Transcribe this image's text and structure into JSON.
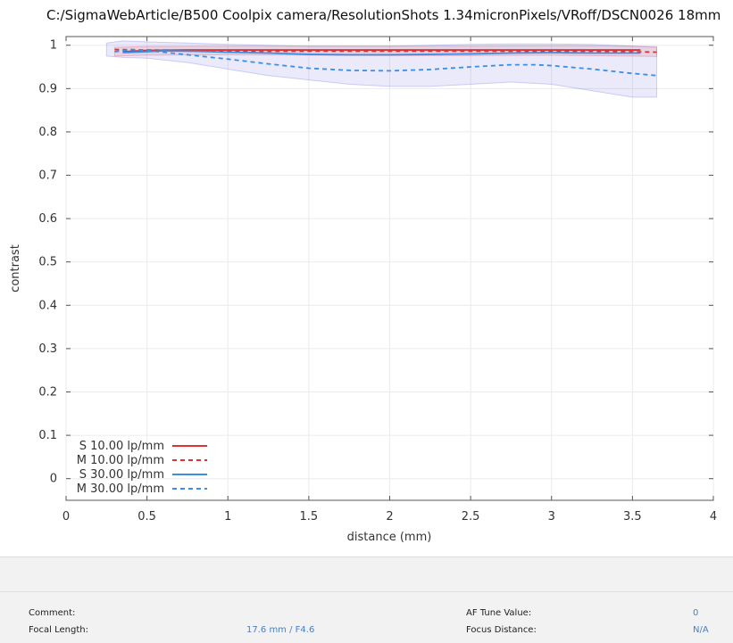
{
  "chart_data": {
    "type": "line",
    "title": "C:/SigmaWebArticle/B500 Coolpix camera/ResolutionShots 1.34micronPixels/VRoff/DSCN0026 18mm",
    "xlabel": "distance (mm)",
    "ylabel": "contrast",
    "xlim": [
      0,
      4
    ],
    "ylim": [
      -0.05,
      1.02
    ],
    "xticks": [
      "0",
      "0.5",
      "1",
      "1.5",
      "2",
      "2.5",
      "3",
      "3.5",
      "4"
    ],
    "yticks": [
      "0",
      "0.1",
      "0.2",
      "0.3",
      "0.4",
      "0.5",
      "0.6",
      "0.7",
      "0.8",
      "0.9",
      "1"
    ],
    "grid": true,
    "legend_position": "bottom-left",
    "series": [
      {
        "name": "S 10.00 lp/mm",
        "color": "#e03030",
        "style": "solid",
        "x": [
          0.35,
          0.5,
          0.75,
          1.0,
          1.25,
          1.5,
          1.75,
          2.0,
          2.25,
          2.5,
          2.75,
          3.0,
          3.25,
          3.55
        ],
        "y": [
          0.985,
          0.988,
          0.989,
          0.989,
          0.989,
          0.989,
          0.989,
          0.989,
          0.989,
          0.989,
          0.989,
          0.989,
          0.989,
          0.989
        ]
      },
      {
        "name": "M 10.00 lp/mm",
        "color": "#e03030",
        "style": "dashed",
        "x": [
          0.3,
          0.5,
          0.75,
          1.0,
          1.25,
          1.5,
          1.75,
          2.0,
          2.25,
          2.5,
          2.75,
          3.0,
          3.25,
          3.5,
          3.65
        ],
        "y": [
          0.99,
          0.989,
          0.988,
          0.987,
          0.986,
          0.986,
          0.986,
          0.986,
          0.986,
          0.986,
          0.986,
          0.986,
          0.986,
          0.985,
          0.984
        ]
      },
      {
        "name": "S 30.00 lp/mm",
        "color": "#3a8ee6",
        "style": "solid",
        "x": [
          0.35,
          0.5,
          0.6,
          0.8,
          1.0,
          1.25,
          1.5,
          1.75,
          2.0,
          2.25,
          2.5,
          2.75,
          3.0,
          3.25,
          3.55
        ],
        "y": [
          0.983,
          0.985,
          0.987,
          0.986,
          0.984,
          0.982,
          0.979,
          0.978,
          0.978,
          0.979,
          0.98,
          0.982,
          0.983,
          0.982,
          0.982
        ]
      },
      {
        "name": "M 30.00 lp/mm",
        "color": "#3a8ee6",
        "style": "dashed",
        "x": [
          0.3,
          0.4,
          0.5,
          0.6,
          0.75,
          1.0,
          1.25,
          1.5,
          1.75,
          2.0,
          2.25,
          2.5,
          2.75,
          2.9,
          3.0,
          3.25,
          3.5,
          3.65
        ],
        "y": [
          0.985,
          0.99,
          0.988,
          0.984,
          0.978,
          0.968,
          0.957,
          0.947,
          0.942,
          0.941,
          0.944,
          0.95,
          0.955,
          0.955,
          0.953,
          0.945,
          0.935,
          0.93
        ]
      }
    ],
    "bands": [
      {
        "color": "#e03030",
        "x": [
          0.3,
          0.5,
          1.0,
          1.5,
          2.0,
          2.5,
          3.0,
          3.5,
          3.65
        ],
        "lower": [
          0.975,
          0.977,
          0.978,
          0.977,
          0.976,
          0.976,
          0.977,
          0.975,
          0.974
        ],
        "upper": [
          0.995,
          0.997,
          0.998,
          0.998,
          0.998,
          0.998,
          0.999,
          0.998,
          0.997
        ]
      },
      {
        "color": "#5050e0",
        "x": [
          0.25,
          0.35,
          0.5,
          0.75,
          1.0,
          1.25,
          1.5,
          1.75,
          2.0,
          2.25,
          2.5,
          2.75,
          3.0,
          3.25,
          3.5,
          3.65
        ],
        "lower": [
          0.975,
          0.972,
          0.97,
          0.96,
          0.945,
          0.93,
          0.92,
          0.91,
          0.905,
          0.905,
          0.91,
          0.915,
          0.91,
          0.895,
          0.88,
          0.88
        ],
        "upper": [
          1.005,
          1.01,
          1.008,
          1.005,
          1.002,
          1.0,
          0.998,
          0.998,
          0.998,
          1.0,
          1.002,
          1.003,
          1.003,
          1.002,
          0.998,
          0.995
        ]
      }
    ]
  },
  "footer": {
    "comment_label": "Comment:",
    "comment_value": "",
    "focal_label": "Focal Length:",
    "focal_value": "17.6 mm / F4.6",
    "af_label": "AF Tune Value:",
    "af_value": "0",
    "focus_label": "Focus Distance:",
    "focus_value": "N/A"
  }
}
